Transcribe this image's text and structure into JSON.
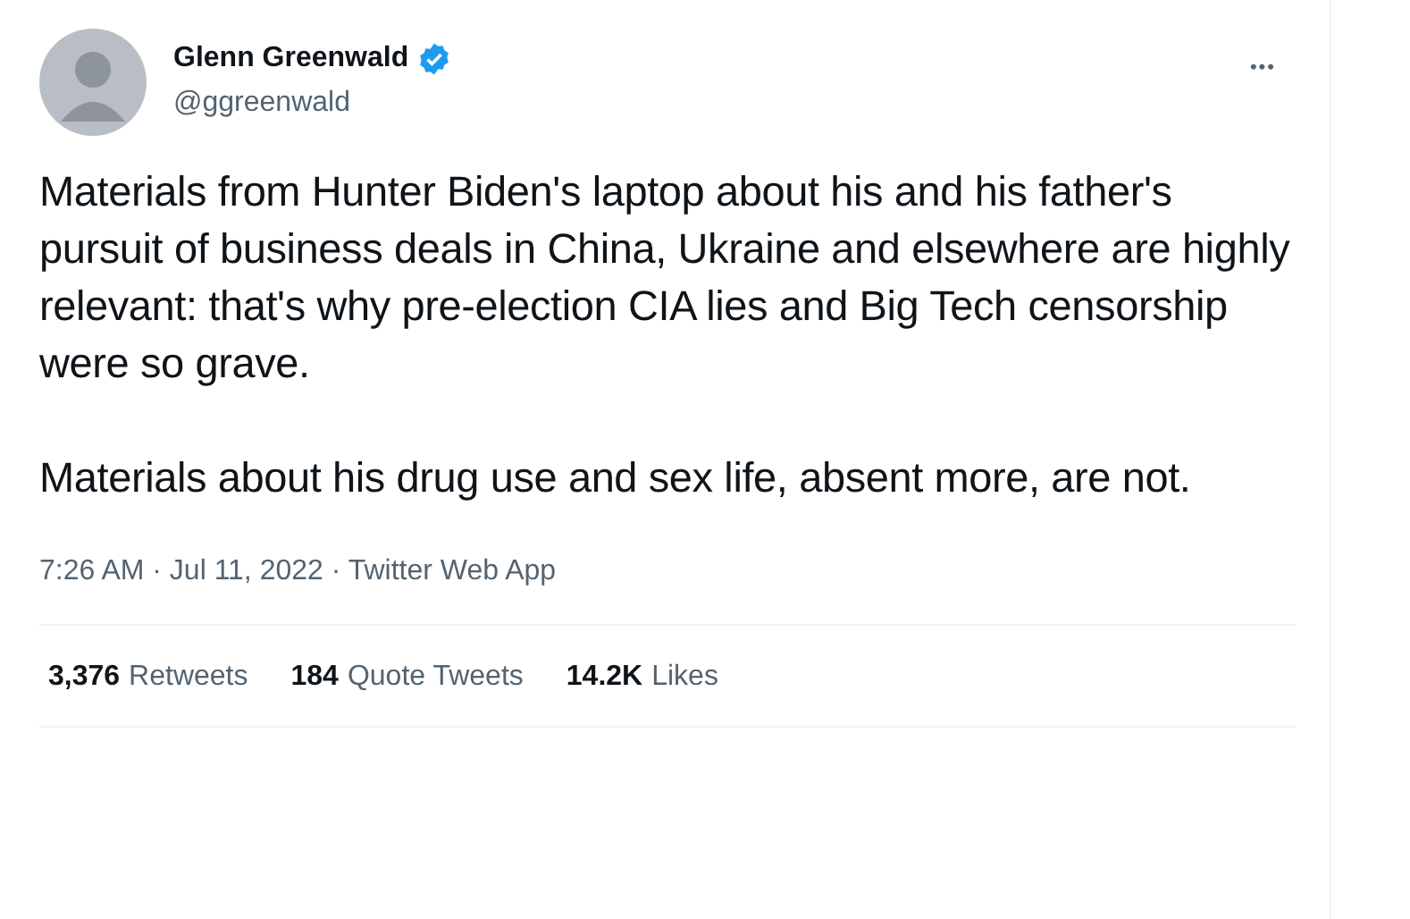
{
  "author": {
    "name": "Glenn Greenwald",
    "verified": true,
    "handle": "@ggreenwald"
  },
  "more_button": "•••",
  "paragraphs": [
    "Materials from Hunter Biden's laptop about his and his father's pursuit of business deals in China, Ukraine and elsewhere are highly relevant: that's why pre-election CIA lies and Big Tech censorship were so grave.",
    "Materials about his drug use and sex life, absent more, are not."
  ],
  "timestamp": "7:26 AM · Jul 11, 2022 · Twitter Web App",
  "stats": [
    {
      "count": "3,376",
      "label": "Retweets"
    },
    {
      "count": "184",
      "label": "Quote Tweets"
    },
    {
      "count": "14.2K",
      "label": "Likes"
    }
  ]
}
